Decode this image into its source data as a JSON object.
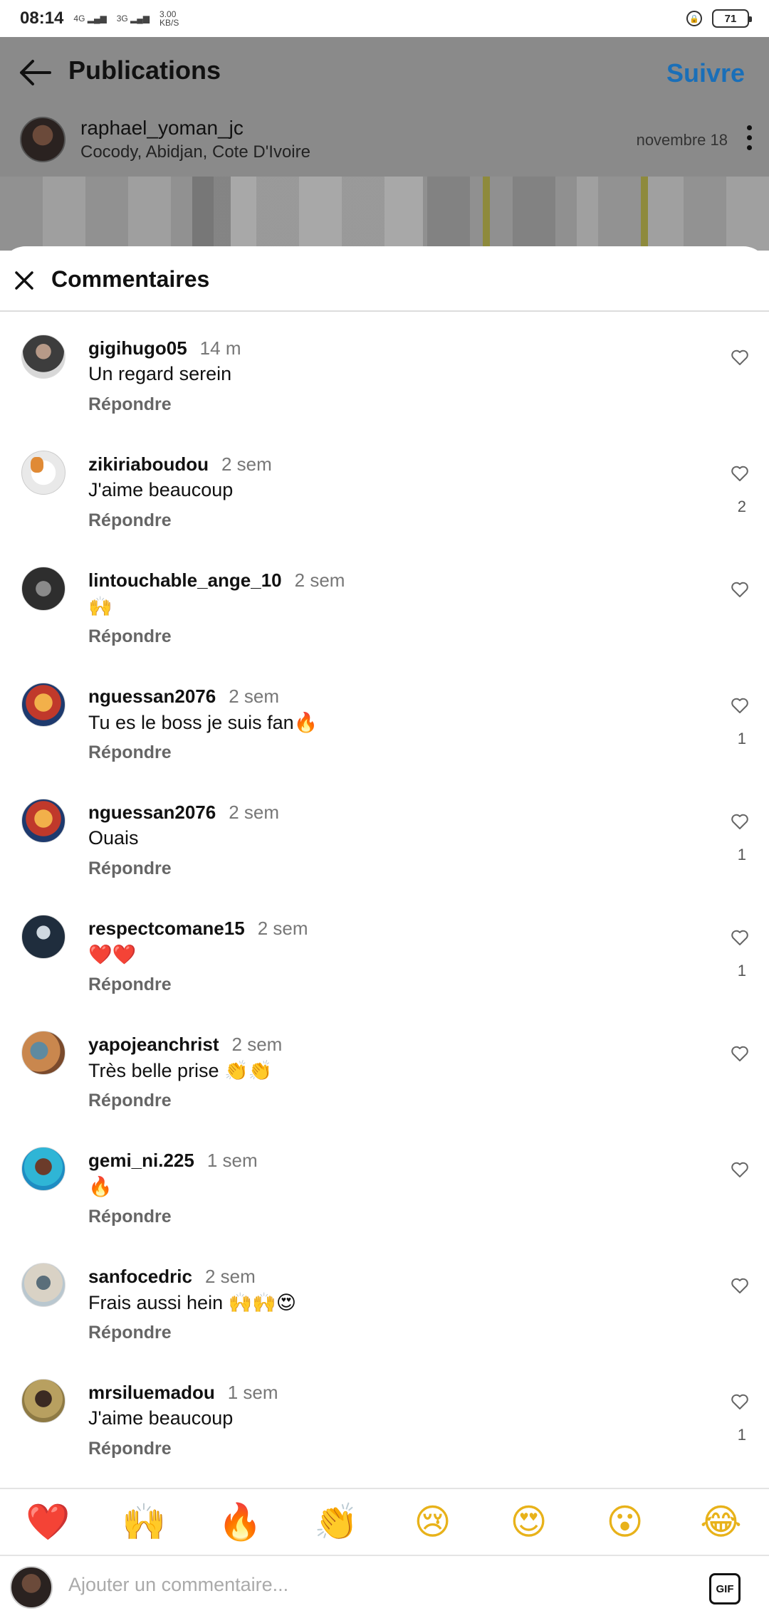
{
  "status_bar": {
    "time": "08:14",
    "net1": "4G",
    "net2": "3G",
    "speed": "3.00",
    "speed_unit": "KB/S",
    "battery": "71"
  },
  "header": {
    "title": "Publications",
    "follow_label": "Suivre"
  },
  "post": {
    "author": "raphael_yoman_jc",
    "location": "Cocody, Abidjan, Cote D'Ivoire",
    "date": "novembre 18"
  },
  "sheet": {
    "title": "Commentaires"
  },
  "reply_label": "Répondre",
  "comments": [
    {
      "user": "gigihugo05",
      "time": "14 m",
      "text": "Un regard serein",
      "likes": ""
    },
    {
      "user": "zikiriaboudou",
      "time": "2 sem",
      "text": "J'aime beaucoup",
      "likes": "2"
    },
    {
      "user": "lintouchable_ange_10",
      "time": "2 sem",
      "text": "🙌",
      "likes": ""
    },
    {
      "user": "nguessan2076",
      "time": "2 sem",
      "text": "Tu es le boss je suis fan🔥",
      "likes": "1"
    },
    {
      "user": "nguessan2076",
      "time": "2 sem",
      "text": "Ouais",
      "likes": "1"
    },
    {
      "user": "respectcomane15",
      "time": "2 sem",
      "text": "❤️❤️",
      "likes": "1"
    },
    {
      "user": "yapojeanchrist",
      "time": "2 sem",
      "text": "Très belle prise 👏👏",
      "likes": ""
    },
    {
      "user": "gemi_ni.225",
      "time": "1 sem",
      "text": "🔥",
      "likes": ""
    },
    {
      "user": "sanfocedric",
      "time": "2 sem",
      "text": "Frais aussi hein 🙌🙌😍",
      "likes": ""
    },
    {
      "user": "mrsiluemadou",
      "time": "1 sem",
      "text": "J'aime beaucoup",
      "likes": "1"
    }
  ],
  "emoji_bar": [
    "❤️",
    "🙌",
    "🔥",
    "👏",
    "😢",
    "😍",
    "😮",
    "😂"
  ],
  "input": {
    "placeholder": "Ajouter un commentaire...",
    "gif_label": "GIF"
  },
  "colors": {
    "accent": "#1a6fb8",
    "dim_overlay": "#8a8a8a"
  }
}
